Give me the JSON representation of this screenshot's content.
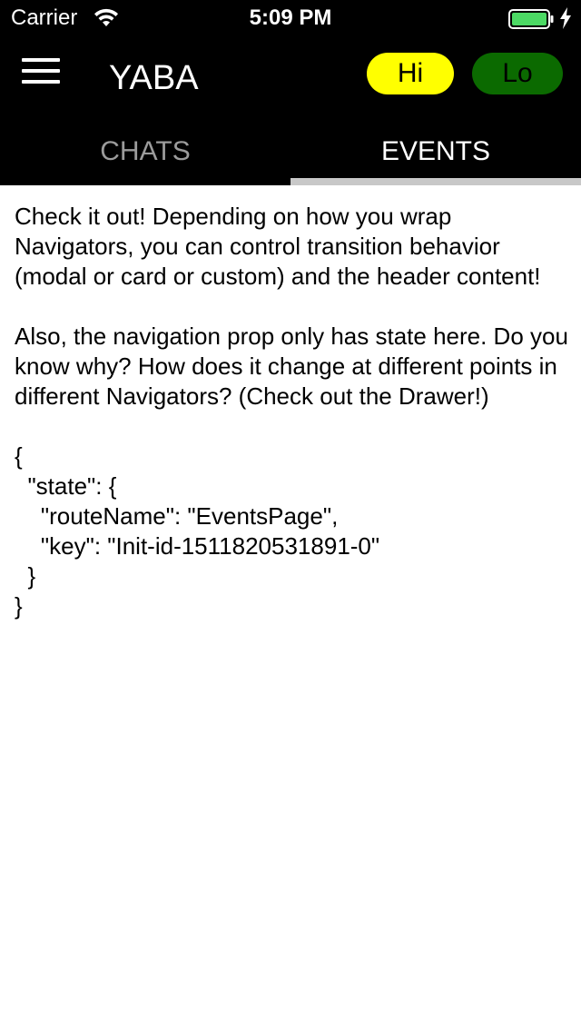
{
  "status_bar": {
    "carrier": "Carrier",
    "time": "5:09 PM",
    "wifi_icon": "wifi-icon",
    "battery_icon": "battery-icon",
    "charging_icon": "charging-bolt-icon",
    "battery_color": "#4cd964"
  },
  "header": {
    "menu_icon": "hamburger-menu-icon",
    "title": "YABA",
    "hi_label": "Hi",
    "lo_label": "Lo",
    "hi_color": "#ffff00",
    "lo_color": "#0b6a00"
  },
  "tabs": [
    {
      "label": "CHATS",
      "active": false
    },
    {
      "label": "EVENTS",
      "active": true
    }
  ],
  "content": {
    "paragraph1": "Check it out! Depending on how you wrap Navigators, you can control transition behavior (modal or card or custom) and the header content!",
    "paragraph2": "Also, the navigation prop only has state here. Do you know why? How does it change at different points in different Navigators? (Check out the Drawer!)",
    "code": "{\n  \"state\": {\n    \"routeName\": \"EventsPage\",\n    \"key\": \"Init-id-1511820531891-0\"\n  }\n}"
  }
}
